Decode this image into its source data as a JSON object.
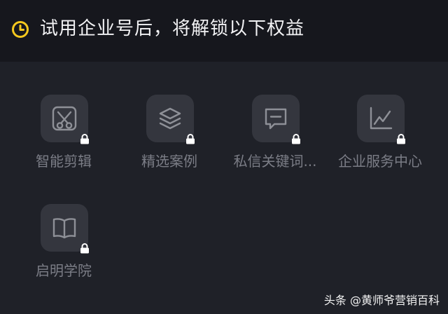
{
  "header": {
    "icon": "clock-icon",
    "title": "试用企业号后，将解锁以下权益",
    "accent": "#f6c81e"
  },
  "features": [
    {
      "label": "智能剪辑",
      "icon": "scissors-icon",
      "locked": true
    },
    {
      "label": "精选案例",
      "icon": "layers-icon",
      "locked": true
    },
    {
      "label": "私信关键词...",
      "icon": "message-icon",
      "locked": true
    },
    {
      "label": "企业服务中心",
      "icon": "chart-icon",
      "locked": true
    },
    {
      "label": "启明学院",
      "icon": "book-icon",
      "locked": true
    }
  ],
  "watermark": {
    "text": "头条 @黄师爷营销百科"
  },
  "colors": {
    "background": "#16171d",
    "panel": "#1f2128",
    "tile": "#34363e",
    "icon_stroke": "#8e9097",
    "label": "#7b7d86"
  }
}
